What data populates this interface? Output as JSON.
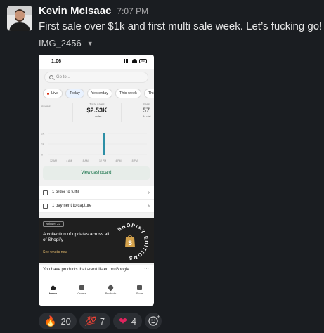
{
  "message": {
    "author": "Kevin McIsaac",
    "time": "7:07 PM",
    "text": "First sale over $1k and first multi sale week. Let’s fucking go!",
    "attachment_name": "IMG_2456",
    "attachment_menu_icon": "caret-down-icon"
  },
  "phone": {
    "status_time": "1:06",
    "battery": "86",
    "search_placeholder": "Go to...",
    "tabs": [
      {
        "label": "Live"
      },
      {
        "label": "Today",
        "active": true
      },
      {
        "label": "Yesterday"
      },
      {
        "label": "This week"
      },
      {
        "label": "This"
      }
    ],
    "stats": {
      "left_label": "ssions",
      "center_label": "Total sales",
      "center_value": "$2.53K",
      "center_sub": "1 order",
      "right_label": "Sessi",
      "right_value": "57",
      "right_sub": "54 visi"
    },
    "chart_ticks_y": [
      "2K",
      "1K",
      "0"
    ],
    "chart_ticks_x": [
      "12 AM",
      "4 AM",
      "8 AM",
      "12 PM",
      "4 PM",
      "8 PM"
    ],
    "view_dashboard": "View dashboard",
    "tasks": [
      {
        "label": "1 order to fulfill"
      },
      {
        "label": "1 payment to capture"
      }
    ],
    "promo": {
      "badge": "Winter '23",
      "title": "A collection of updates across all of Shopify",
      "link": "See what's new",
      "ring_text": "SHOPIFY EDITIONS"
    },
    "listing": {
      "text": "You have products that aren't listed on Google",
      "more": "···"
    },
    "nav": [
      {
        "label": "Home",
        "active": true
      },
      {
        "label": "Orders"
      },
      {
        "label": "Products"
      },
      {
        "label": "Store"
      }
    ]
  },
  "reactions": [
    {
      "emoji": "🔥",
      "count": "20"
    },
    {
      "emoji": "💯",
      "count": "7"
    },
    {
      "emoji": "❤",
      "count": "4"
    }
  ],
  "colors": {
    "background": "#1a1d21",
    "reaction_bg": "#2b2e33",
    "chart_bar": "#2d8fa6",
    "shopify_green": "#0f6e44"
  },
  "chart_data": {
    "type": "bar",
    "categories": [
      "12 AM",
      "4 AM",
      "8 AM",
      "12 PM",
      "4 PM",
      "8 PM"
    ],
    "values": [
      0,
      0,
      0,
      2530,
      0,
      0
    ],
    "ylim": [
      0,
      2500
    ]
  }
}
